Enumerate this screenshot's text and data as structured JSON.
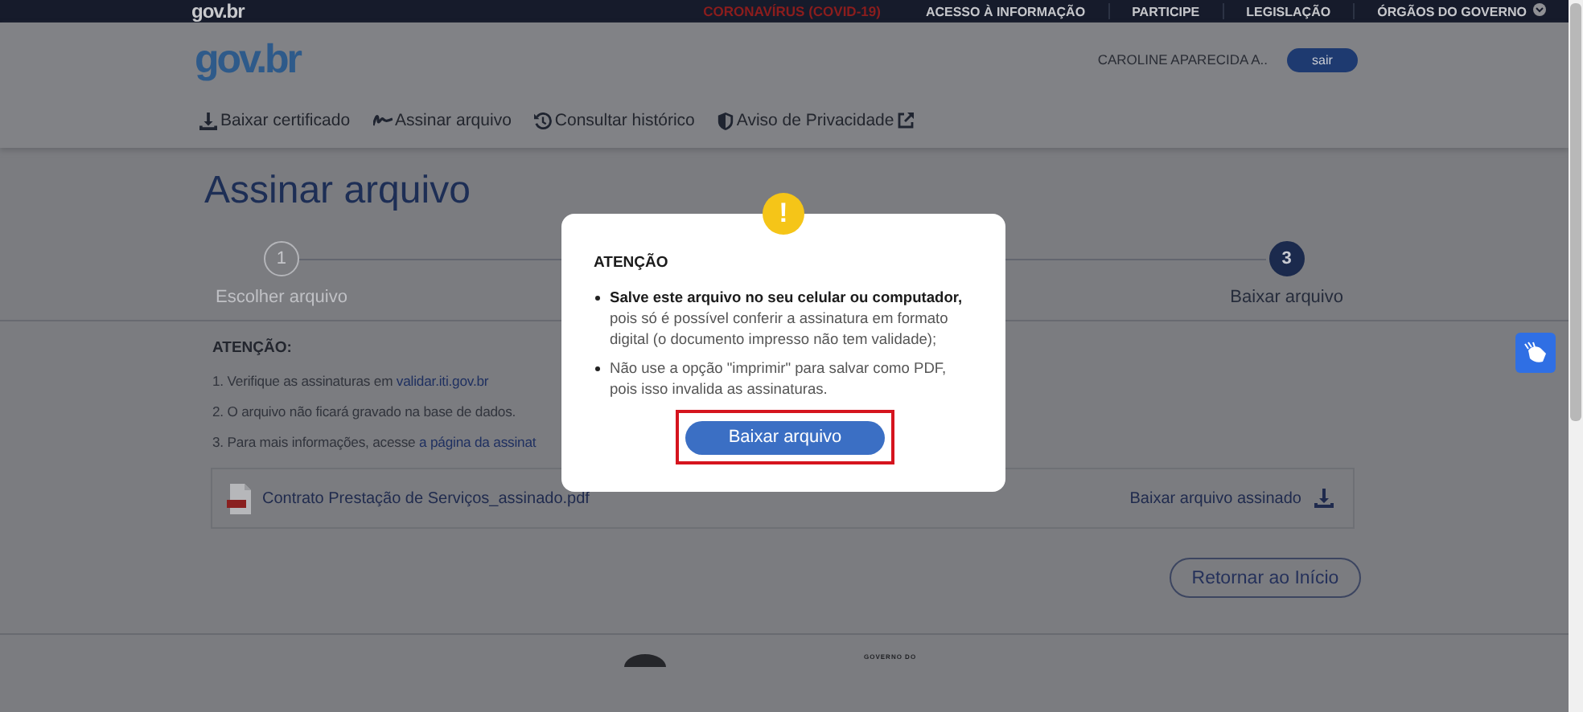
{
  "top_bar": {
    "logo": "gov.br",
    "links": [
      {
        "label": "CORONAVÍRUS (COVID-19)",
        "kind": "alert"
      },
      {
        "label": "ACESSO À INFORMAÇÃO",
        "kind": "plain"
      },
      {
        "label": "PARTICIPE",
        "kind": "plain"
      },
      {
        "label": "LEGISLAÇÃO",
        "kind": "plain"
      },
      {
        "label": "ÓRGÃOS DO GOVERNO",
        "kind": "dropdown"
      }
    ]
  },
  "header": {
    "logo": "gov.br",
    "user": "CAROLINE APARECIDA A..",
    "logout": "sair",
    "nav": [
      {
        "label": "Baixar certificado",
        "kind": "download"
      },
      {
        "label": "Assinar arquivo",
        "kind": "signature"
      },
      {
        "label": "Consultar histórico",
        "kind": "history"
      },
      {
        "label": "Aviso de Privacidade",
        "kind": "shield",
        "external": true
      }
    ]
  },
  "page_title": "Assinar arquivo",
  "steps": [
    {
      "number": "1",
      "label": "Escolher arquivo",
      "selected": false
    },
    {
      "number": "3",
      "label": "Baixar arquivo",
      "selected": true
    }
  ],
  "notice": {
    "title": "ATENÇÃO:",
    "items": [
      {
        "text": "1. Verifique as assinaturas em ",
        "link": "validar.iti.gov.br"
      },
      {
        "text": "2. O arquivo não ficará gravado na base de dados."
      },
      {
        "text": "3. Para mais informações, acesse ",
        "link": "a página da assinat"
      }
    ]
  },
  "file": {
    "name": "Contrato Prestação de Serviços_assinado.pdf",
    "download": "Baixar arquivo assinado"
  },
  "return_button": "Retornar ao Início",
  "footer": {
    "text": "GOVERNO DO"
  },
  "modal": {
    "icon": "!",
    "title": "ATENÇÃO",
    "bullets": [
      "**Salve este arquivo no seu celular ou computador,** pois só é possível conferir a assinatura em formato digital (o documento impresso não tem validade);",
      "Não use a opção \"imprimir\" para salvar como PDF, pois isso invalida as assinaturas."
    ],
    "button": "Baixar arquivo",
    "highlighted": true
  }
}
